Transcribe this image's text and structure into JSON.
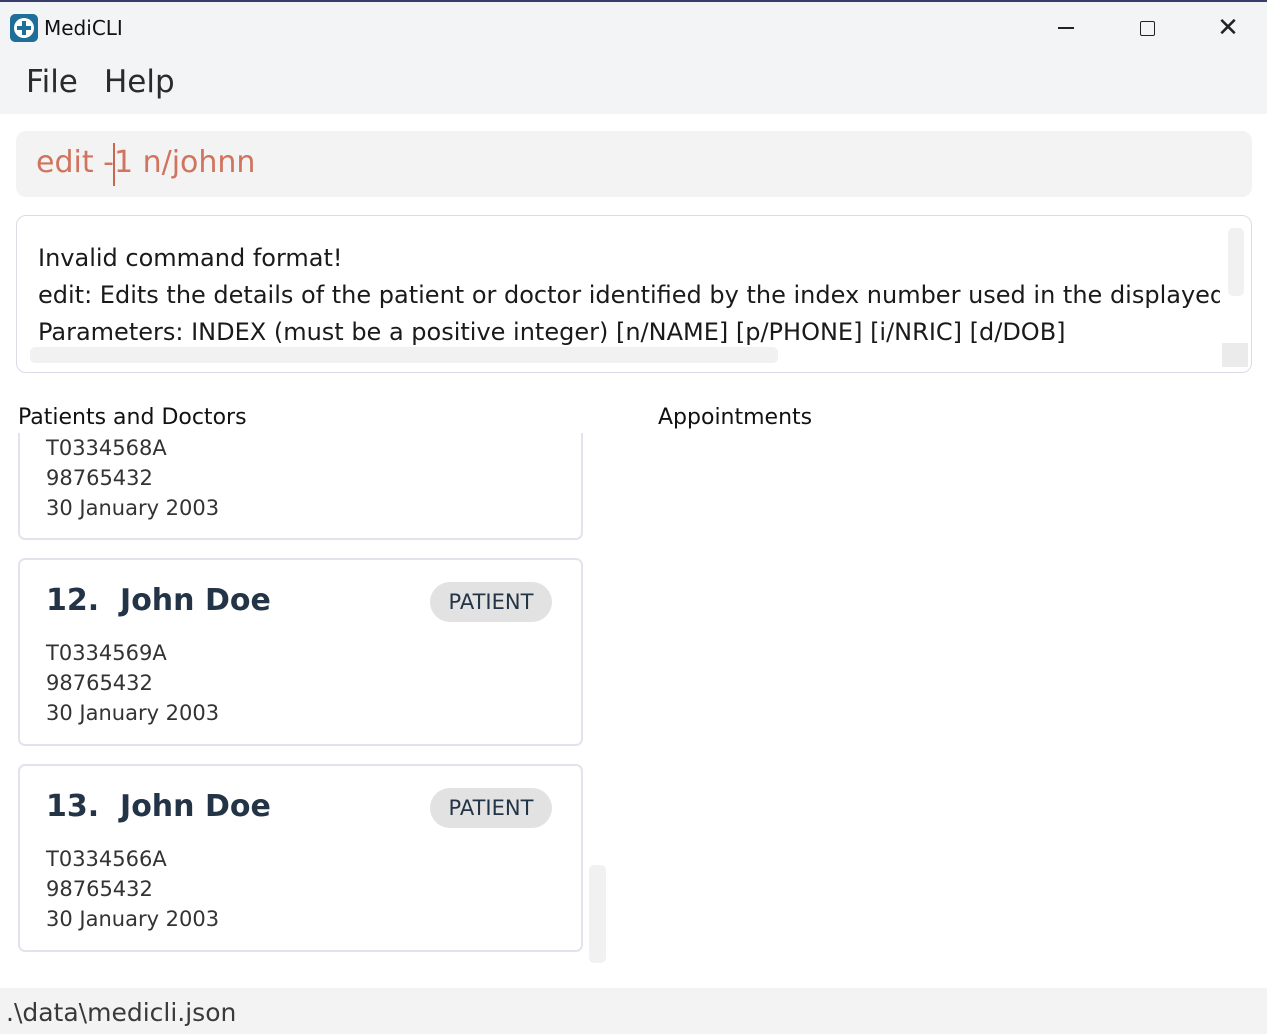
{
  "window": {
    "title": "MediCLI",
    "icon": "medical-cross-icon",
    "controls": [
      "minimize-icon",
      "maximize-icon",
      "close-icon"
    ]
  },
  "menu": {
    "file": "File",
    "help": "Help"
  },
  "command": {
    "value": "edit -1 n/johnn"
  },
  "result": {
    "lines": [
      "Invalid command format!",
      "edit: Edits the details of the patient or doctor identified by the index number used in the displayed person list.",
      "Parameters: INDEX (must be a positive integer) [n/NAME] [p/PHONE] [i/NRIC] [d/DOB]"
    ]
  },
  "panels": {
    "persons_label": "Patients and Doctors",
    "appointments_label": "Appointments"
  },
  "persons": [
    {
      "title": "",
      "type": "",
      "nric": "T0334568A",
      "phone": "98765432",
      "dob": "30 January 2003"
    },
    {
      "title": "12.  John Doe",
      "type": "PATIENT",
      "nric": "T0334569A",
      "phone": "98765432",
      "dob": "30 January 2003"
    },
    {
      "title": "13.  John Doe",
      "type": "PATIENT",
      "nric": "T0334566A",
      "phone": "98765432",
      "dob": "30 January 2003"
    }
  ],
  "status": {
    "path": ".\\data\\medicli.json"
  },
  "colors": {
    "command_text": "#d0745d",
    "card_title": "#243447",
    "badge_bg": "#e2e2e2",
    "title_bar_bg": "#f3f4f6"
  }
}
